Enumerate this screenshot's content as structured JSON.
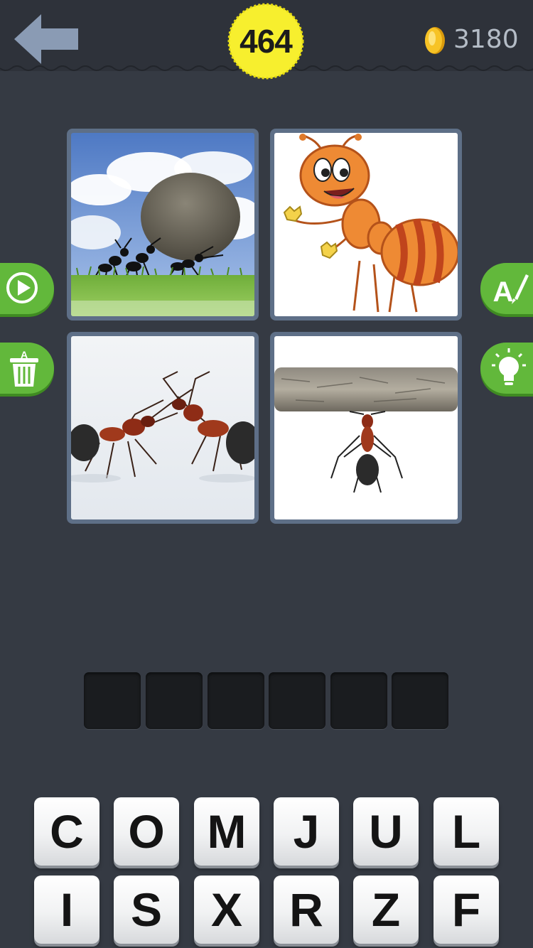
{
  "header": {
    "level": "464",
    "coins": "3180",
    "back_icon": "back-arrow-icon",
    "coin_icon": "coin-icon"
  },
  "colors": {
    "background": "#353a43",
    "badge": "#f7ef2e",
    "side_button": "#62b83b",
    "tile_border": "#5e6f87",
    "slot": "#1a1c1f"
  },
  "pictures": [
    {
      "name": "ants-pushing-rock"
    },
    {
      "name": "cartoon-orange-ant"
    },
    {
      "name": "two-ants-facing"
    },
    {
      "name": "ant-lifting-branch"
    }
  ],
  "side_buttons": {
    "left": [
      "play-video-icon",
      "remove-letters-trash-icon"
    ],
    "right": [
      "reveal-letter-icon",
      "hint-lightbulb-icon"
    ]
  },
  "answer": {
    "slots": [
      "",
      "",
      "",
      "",
      "",
      ""
    ]
  },
  "keyboard": {
    "row1": [
      "C",
      "O",
      "M",
      "J",
      "U",
      "L"
    ],
    "row2": [
      "I",
      "S",
      "X",
      "R",
      "Z",
      "F"
    ]
  }
}
